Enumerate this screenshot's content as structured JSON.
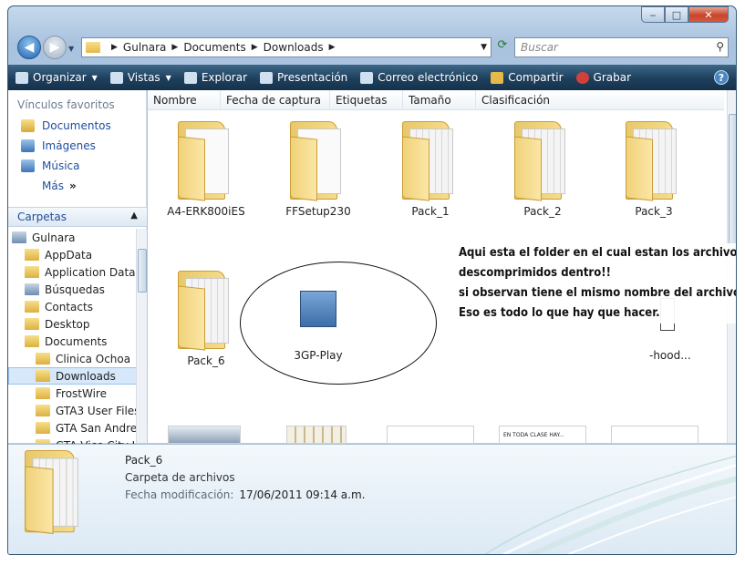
{
  "window": {
    "min": "‒",
    "max": "□",
    "close": "✕"
  },
  "address": {
    "crumbs": [
      "Gulnara",
      "Documents",
      "Downloads"
    ],
    "search_placeholder": "Buscar"
  },
  "toolbar": {
    "organize": "Organizar",
    "views": "Vistas",
    "explore": "Explorar",
    "presentation": "Presentación",
    "email": "Correo electrónico",
    "share": "Compartir",
    "burn": "Grabar"
  },
  "nav": {
    "favorites_title": "Vínculos favoritos",
    "favorites": [
      "Documentos",
      "Imágenes",
      "Música",
      "Más"
    ],
    "folders_title": "Carpetas",
    "tree": [
      "Gulnara",
      "AppData",
      "Application Data",
      "Búsquedas",
      "Contacts",
      "Desktop",
      "Documents",
      "Clinica Ochoa",
      "Downloads",
      "FrostWire",
      "GTA3 User Files",
      "GTA San Andreas",
      "GTA Vice City U"
    ]
  },
  "columns": [
    "Nombre",
    "Fecha de captura",
    "Etiquetas",
    "Tamaño",
    "Clasificación"
  ],
  "files": {
    "row1": [
      "A4-ERK800iES",
      "FFSetup230",
      "Pack_1",
      "Pack_2",
      "Pack_3"
    ],
    "row2": [
      "Pack_6",
      "3GP-Play",
      "-hood..."
    ]
  },
  "annotation": [
    "Aqui esta el folder en el cual estan los archivos",
    "descomprimidos dentro!!",
    "si observan tiene el mismo nombre del archivo descargado...",
    "Eso es todo lo que hay que hacer."
  ],
  "thumb_text": "EN TODA CLASE HAY...",
  "details": {
    "name": "Pack_6",
    "type": "Carpeta de archivos",
    "date_label": "Fecha modificación:",
    "date_value": "17/06/2011 09:14 a.m."
  },
  "colors": {
    "toolbar": "#1e3f5c",
    "link": "#1f4ea1",
    "selection": "#d6e8f9"
  }
}
